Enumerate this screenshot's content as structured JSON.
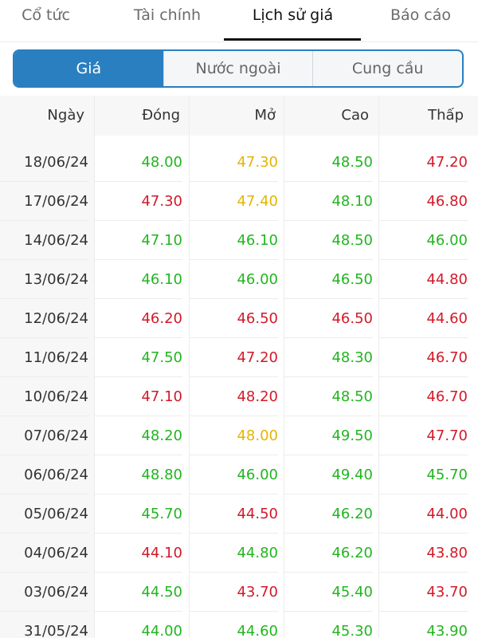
{
  "top_tabs": [
    {
      "label": "Cổ tức",
      "active": false
    },
    {
      "label": "Tài chính",
      "active": false
    },
    {
      "label": "Lịch sử giá",
      "active": true
    },
    {
      "label": "Báo cáo",
      "active": false
    }
  ],
  "segments": [
    {
      "label": "Giá",
      "active": true
    },
    {
      "label": "Nước ngoài",
      "active": false
    },
    {
      "label": "Cung cầu",
      "active": false
    }
  ],
  "colors": {
    "accent": "#2a7fc0",
    "up": "#22b51f",
    "down": "#d11a2a",
    "ref": "#e5b400"
  },
  "table": {
    "headers": [
      "Ngày",
      "Đóng",
      "Mở",
      "Cao",
      "Thấp"
    ],
    "rows": [
      {
        "date": "18/06/24",
        "close": {
          "v": "48.00",
          "c": "up"
        },
        "open": {
          "v": "47.30",
          "c": "ref"
        },
        "high": {
          "v": "48.50",
          "c": "up"
        },
        "low": {
          "v": "47.20",
          "c": "down"
        }
      },
      {
        "date": "17/06/24",
        "close": {
          "v": "47.30",
          "c": "down"
        },
        "open": {
          "v": "47.40",
          "c": "ref"
        },
        "high": {
          "v": "48.10",
          "c": "up"
        },
        "low": {
          "v": "46.80",
          "c": "down"
        }
      },
      {
        "date": "14/06/24",
        "close": {
          "v": "47.10",
          "c": "up"
        },
        "open": {
          "v": "46.10",
          "c": "up"
        },
        "high": {
          "v": "48.50",
          "c": "up"
        },
        "low": {
          "v": "46.00",
          "c": "up"
        }
      },
      {
        "date": "13/06/24",
        "close": {
          "v": "46.10",
          "c": "up"
        },
        "open": {
          "v": "46.00",
          "c": "up"
        },
        "high": {
          "v": "46.50",
          "c": "up"
        },
        "low": {
          "v": "44.80",
          "c": "down"
        }
      },
      {
        "date": "12/06/24",
        "close": {
          "v": "46.20",
          "c": "down"
        },
        "open": {
          "v": "46.50",
          "c": "down"
        },
        "high": {
          "v": "46.50",
          "c": "down"
        },
        "low": {
          "v": "44.60",
          "c": "down"
        }
      },
      {
        "date": "11/06/24",
        "close": {
          "v": "47.50",
          "c": "up"
        },
        "open": {
          "v": "47.20",
          "c": "down"
        },
        "high": {
          "v": "48.30",
          "c": "up"
        },
        "low": {
          "v": "46.70",
          "c": "down"
        }
      },
      {
        "date": "10/06/24",
        "close": {
          "v": "47.10",
          "c": "down"
        },
        "open": {
          "v": "48.20",
          "c": "down"
        },
        "high": {
          "v": "48.50",
          "c": "up"
        },
        "low": {
          "v": "46.70",
          "c": "down"
        }
      },
      {
        "date": "07/06/24",
        "close": {
          "v": "48.20",
          "c": "up"
        },
        "open": {
          "v": "48.00",
          "c": "ref"
        },
        "high": {
          "v": "49.50",
          "c": "up"
        },
        "low": {
          "v": "47.70",
          "c": "down"
        }
      },
      {
        "date": "06/06/24",
        "close": {
          "v": "48.80",
          "c": "up"
        },
        "open": {
          "v": "46.00",
          "c": "up"
        },
        "high": {
          "v": "49.40",
          "c": "up"
        },
        "low": {
          "v": "45.70",
          "c": "up"
        }
      },
      {
        "date": "05/06/24",
        "close": {
          "v": "45.70",
          "c": "up"
        },
        "open": {
          "v": "44.50",
          "c": "down"
        },
        "high": {
          "v": "46.20",
          "c": "up"
        },
        "low": {
          "v": "44.00",
          "c": "down"
        }
      },
      {
        "date": "04/06/24",
        "close": {
          "v": "44.10",
          "c": "down"
        },
        "open": {
          "v": "44.80",
          "c": "up"
        },
        "high": {
          "v": "46.20",
          "c": "up"
        },
        "low": {
          "v": "43.80",
          "c": "down"
        }
      },
      {
        "date": "03/06/24",
        "close": {
          "v": "44.50",
          "c": "up"
        },
        "open": {
          "v": "43.70",
          "c": "down"
        },
        "high": {
          "v": "45.40",
          "c": "up"
        },
        "low": {
          "v": "43.70",
          "c": "down"
        }
      },
      {
        "date": "31/05/24",
        "close": {
          "v": "44.00",
          "c": "up"
        },
        "open": {
          "v": "44.60",
          "c": "up"
        },
        "high": {
          "v": "45.30",
          "c": "up"
        },
        "low": {
          "v": "43.90",
          "c": "up"
        }
      }
    ]
  }
}
